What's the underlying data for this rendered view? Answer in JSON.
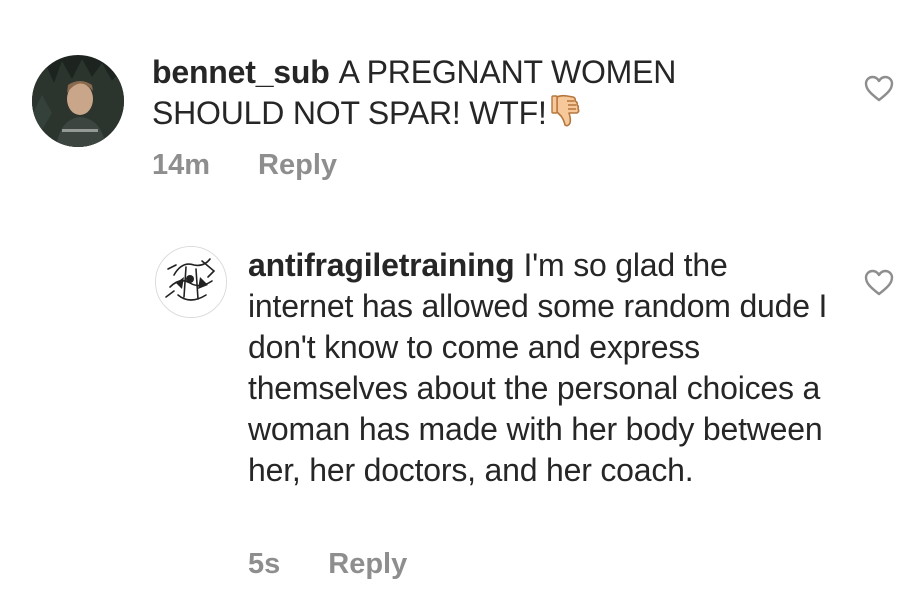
{
  "comments": [
    {
      "username": "bennet_sub",
      "text": "A PREGNANT WOMEN SHOULD NOT SPAR! WTF!",
      "emoji": "thumbs-down",
      "time": "14m",
      "reply_label": "Reply"
    },
    {
      "username": "antifragiletraining",
      "text": "I'm so glad the internet has allowed some random dude I don't know to come and express themselves about the personal choices a woman has made with her body between her, her doctors, and her coach.",
      "time": "5s",
      "reply_label": "Reply"
    }
  ],
  "colors": {
    "text": "#262626",
    "meta": "#8e8e8e",
    "heart": "#8e8e8e"
  }
}
